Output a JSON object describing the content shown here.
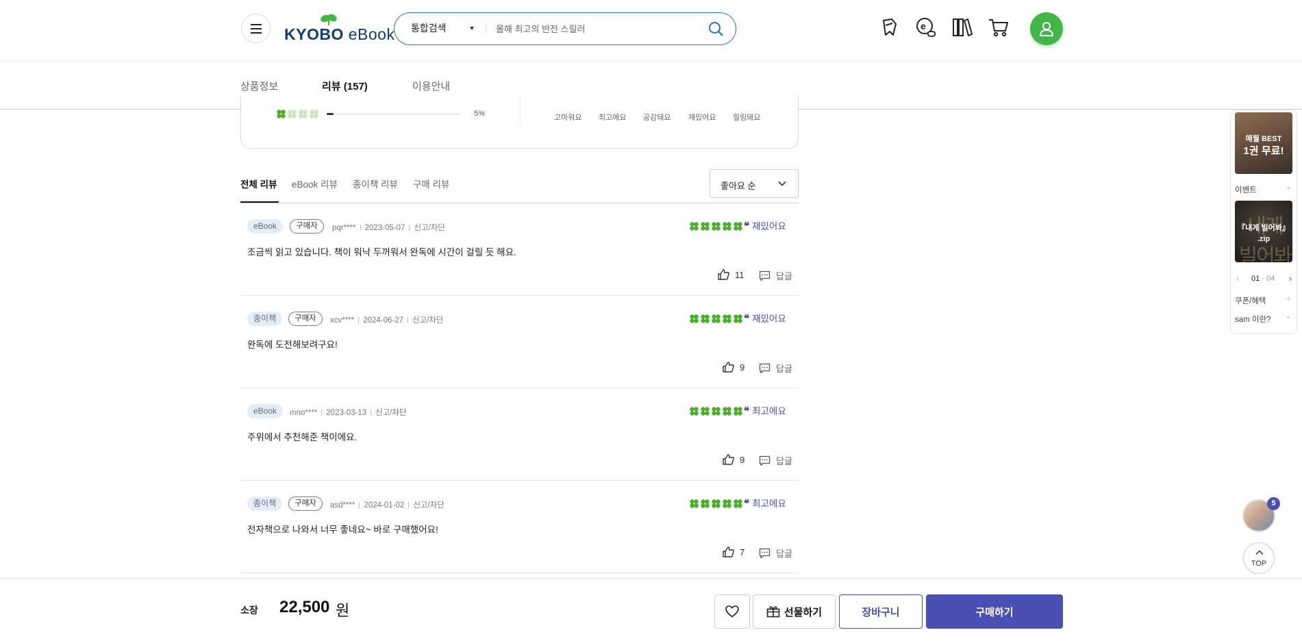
{
  "header": {
    "logo": {
      "brand": "KYOBO",
      "product": "eBook"
    },
    "search": {
      "scope": "통합검색",
      "placeholder": "올해 최고의 반전 스릴러"
    }
  },
  "tabs": [
    {
      "label": "상품정보",
      "active": false
    },
    {
      "label": "리뷰 (157)",
      "active": true
    },
    {
      "label": "이용안내",
      "active": false
    }
  ],
  "rating_summary": {
    "last_row": {
      "score": 1,
      "percent_label": "5%",
      "percent": 5
    },
    "emotion_tags": [
      "고마워요",
      "최고에요",
      "공감돼요",
      "재밌어요",
      "힐링돼요"
    ]
  },
  "review_filter": {
    "tabs": [
      "전체 리뷰",
      "eBook 리뷰",
      "종이책 리뷰",
      "구매 리뷰"
    ],
    "active_tab": "전체 리뷰",
    "sort": "좋아요 순"
  },
  "reviews": [
    {
      "type": "eBook",
      "buyer": "구매자",
      "user": "pqr****",
      "date": "2023-05-07",
      "report": "신고/차단",
      "rating": 5,
      "emotion": "재밌어요",
      "text": "조금씩 읽고 있습니다. 책이 워낙 두꺼워서 완독에 시간이 걸릴 듯 해요.",
      "likes": "11",
      "reply": "답글"
    },
    {
      "type": "종이책",
      "buyer": "구매자",
      "user": "xcv****",
      "date": "2024-06-27",
      "report": "신고/차단",
      "rating": 5,
      "emotion": "재밌어요",
      "text": "완독에 도전해보려구요!",
      "likes": "9",
      "reply": "답글"
    },
    {
      "type": "eBook",
      "buyer": "",
      "user": "mno****",
      "date": "2023-03-13",
      "report": "신고/차단",
      "rating": 5,
      "emotion": "최고에요",
      "text": "주위에서 추천해준 책이에요.",
      "likes": "9",
      "reply": "답글"
    },
    {
      "type": "종이책",
      "buyer": "구매자",
      "user": "asd****",
      "date": "2024-01-02",
      "report": "신고/차단",
      "rating": 5,
      "emotion": "최고에요",
      "text": "전자책으로 나와서 너무 좋네요~ 바로 구매했어요!",
      "likes": "7",
      "reply": "답글"
    }
  ],
  "quick_menu": {
    "banner1": {
      "line1": "매월 BEST",
      "line2": "1권 무료!"
    },
    "event_label": "이벤트",
    "banner2": {
      "bg_text": "내게 빌어봐",
      "line1": "『내게 빌어봐』",
      "line2": ".zip"
    },
    "pager": {
      "current": "01",
      "total": "04"
    },
    "coupon_label": "쿠폰/혜택",
    "sam_label": "sam 이란?"
  },
  "floating": {
    "badge_count": "5",
    "top_label": "TOP"
  },
  "buybar": {
    "own_label": "소장",
    "price": "22,500",
    "price_unit": "원",
    "gift_label": "선물하기",
    "cart_label": "장바구니",
    "buy_label": "구매하기"
  },
  "colors": {
    "accent": "#4a4fb3",
    "brand_green": "#43b649",
    "clover_green": "#4cae2a",
    "search_border": "#2c6bdb"
  },
  "icons": [
    "menu-icon",
    "search-icon",
    "bookmark-ribbon-icon",
    "e-coin-icon",
    "library-icon",
    "cart-icon",
    "user-icon",
    "clover-icon",
    "thumbs-up-icon",
    "comment-icon",
    "chevron-down-icon",
    "heart-icon",
    "gift-icon",
    "chevron-up-icon"
  ]
}
